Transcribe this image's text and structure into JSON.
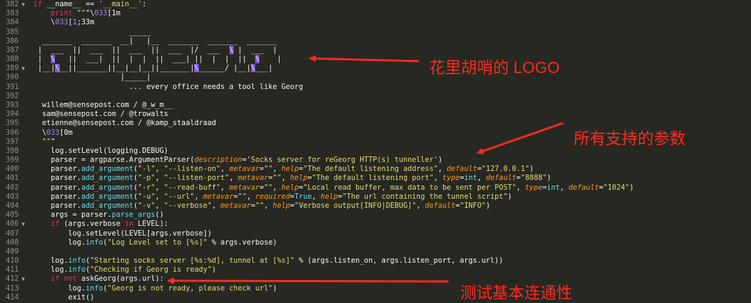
{
  "code_lines": [
    {
      "n": "382",
      "fold": "▼",
      "t": "if __name__ == '__main__':"
    },
    {
      "n": "383",
      "fold": "",
      "t": "    print \"\"\"\\033[1m"
    },
    {
      "n": "384",
      "fold": "",
      "t": "    \\033[1;33m"
    },
    {
      "n": "385",
      "fold": "",
      "t": "                      _____"
    },
    {
      "n": "386",
      "fold": "",
      "t": "  _______  _______  __|   |__  _______  _______  _______"
    },
    {
      "n": "387",
      "fold": "",
      "t": " |  ___  ||  ___  ||  ___  ||  ___  |/  ___  \\ |  ___  |"
    },
    {
      "n": "388",
      "fold": "",
      "t": " |  \\   ||  ___|  ||  |  |  ||  ___| ||  |  |  ||  \\    |"
    },
    {
      "n": "389",
      "fold": "▼",
      "t": " |__|\\__||_______||__|__|__||_______|\\______/ |__|\\___|"
    },
    {
      "n": "390",
      "fold": "",
      "t": "                    |_____|"
    },
    {
      "n": "391",
      "fold": "",
      "t": "                      ... every office needs a tool like Georg"
    },
    {
      "n": "392",
      "fold": "",
      "t": ""
    },
    {
      "n": "393",
      "fold": "",
      "t": "  willem@sensepost.com / @_w_m__"
    },
    {
      "n": "394",
      "fold": "",
      "t": "  sam@sensepost.com / @trowalts"
    },
    {
      "n": "395",
      "fold": "",
      "t": "  etienne@sensepost.com / @kamp_staaldraad"
    },
    {
      "n": "396",
      "fold": "",
      "t": "  \\033[0m"
    },
    {
      "n": "397",
      "fold": "",
      "t": "  \"\"\""
    },
    {
      "n": "398",
      "fold": "",
      "t": "    log.setLevel(logging.DEBUG)"
    },
    {
      "n": "399",
      "fold": "",
      "t": "    parser = argparse.ArgumentParser(description='Socks server for reGeorg HTTP(s) tunneller')"
    },
    {
      "n": "400",
      "fold": "",
      "t": "    parser.add_argument(\"-l\", \"--listen-on\", metavar=\"\", help=\"The default listening address\", default=\"127.0.0.1\")"
    },
    {
      "n": "401",
      "fold": "",
      "t": "    parser.add_argument(\"-p\", \"--listen-port\", metavar=\"\", help=\"The default listening port\", type=int, default=\"8888\")"
    },
    {
      "n": "402",
      "fold": "",
      "t": "    parser.add_argument(\"-r\", \"--read-buff\", metavar=\"\", help=\"Local read buffer, max data to be sent per POST\", type=int, default=\"1024\")"
    },
    {
      "n": "403",
      "fold": "",
      "t": "    parser.add_argument(\"-u\", \"--url\", metavar=\"\", required=True, help=\"The url containing the tunnel script\")"
    },
    {
      "n": "404",
      "fold": "",
      "t": "    parser.add_argument(\"-v\", \"--verbose\", metavar=\"\", help=\"Verbose output[INFO|DEBUG]\", default=\"INFO\")"
    },
    {
      "n": "405",
      "fold": "",
      "t": "    args = parser.parse_args()"
    },
    {
      "n": "406",
      "fold": "▼",
      "t": "    if (args.verbose in LEVEL):"
    },
    {
      "n": "407",
      "fold": "",
      "t": "        log.setLevel(LEVEL[args.verbose])"
    },
    {
      "n": "408",
      "fold": "",
      "t": "        log.info(\"Log Level set to [%s]\" % args.verbose)"
    },
    {
      "n": "409",
      "fold": "",
      "t": ""
    },
    {
      "n": "410",
      "fold": "",
      "t": "    log.info(\"Starting socks server [%s:%d], tunnel at [%s]\" % (args.listen_on, args.listen_port, args.url))"
    },
    {
      "n": "411",
      "fold": "",
      "t": "    log.info(\"Checking if Georg is ready\")"
    },
    {
      "n": "412",
      "fold": "▼",
      "t": "    if not askGeorg(args.url):"
    },
    {
      "n": "413",
      "fold": "",
      "t": "        log.info(\"Georg is not ready, please check url\")"
    },
    {
      "n": "414",
      "fold": "",
      "t": "        exit()"
    }
  ],
  "annotations": {
    "logo": "花里胡哨的 LOGO",
    "params": "所有支持的参数",
    "connectivity": "测试基本连通性"
  },
  "colors": {
    "background": "#272822",
    "annotation": "#ff2a1f",
    "keyword": "#f92672",
    "function": "#66d9ef",
    "string": "#e6db74",
    "number": "#ae81ff",
    "parameter": "#fd971f"
  }
}
